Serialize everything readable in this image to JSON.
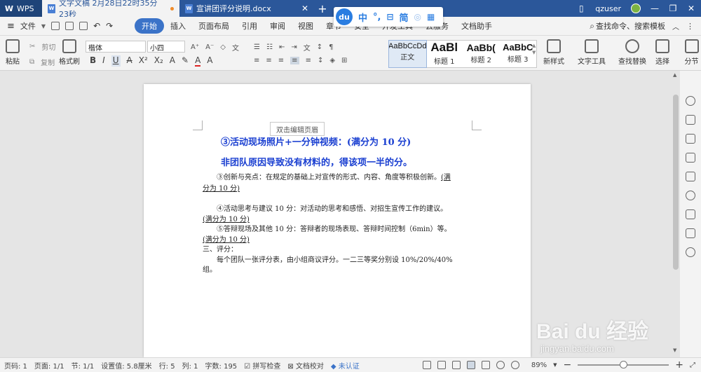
{
  "titlebar": {
    "app_tab": "WPS",
    "tabs": [
      {
        "label": "文字文稿 2月28日22时35分23秒",
        "active": true
      },
      {
        "label": "宣讲团评分说明.docx",
        "active": false
      }
    ],
    "user": "qzuser"
  },
  "ime": {
    "logo": "du",
    "items": [
      "中",
      "°,",
      "简"
    ]
  },
  "menubar": {
    "file": "文件",
    "items": [
      "开始",
      "插入",
      "页面布局",
      "引用",
      "审阅",
      "视图",
      "章节",
      "安全",
      "开发工具",
      "云服务",
      "文档助手"
    ],
    "active": "开始",
    "search": "查找命令、搜索模板"
  },
  "ribbon": {
    "paste": "粘贴",
    "cut": "剪切",
    "copy": "复制",
    "format_painter": "格式刷",
    "font": "楷体",
    "size": "小四",
    "styles": [
      {
        "sample": "AaBbCcDd",
        "name": "正文"
      },
      {
        "sample": "AaBl",
        "name": "标题 1"
      },
      {
        "sample": "AaBb(",
        "name": "标题 2"
      },
      {
        "sample": "AaBbC",
        "name": "标题 3"
      }
    ],
    "new_style": "新样式",
    "text_tools": "文字工具",
    "find_replace": "查找替换",
    "select": "选择",
    "more": "分节"
  },
  "document": {
    "header_tip": "双击编辑页眉",
    "title1": "③活动现场照片+一分钟视频：(满分为 10 分)",
    "title2": "非团队原因导致没有材料的，得该项一半的分。",
    "p3a": "③创新与亮点：在规定的基础上对宣传的形式、内容、角度等积极创新。",
    "p3b": "(满",
    "p3c": "分为 10 分)",
    "p4a": "④活动思考与建议 10 分：对活动的思考和感悟、对招生宣传工作的建议。",
    "p4b": "(满分为 10 分)",
    "p5a": "⑤答辩现场及其他 10 分：答辩者的现场表现、答辩时间控制（6min）等。",
    "p5b": "(满分为 10 分)",
    "p6": "三、评分：",
    "p7a": "每个团队一张评分表，由小组商议评分。一二三等奖分别设 10%/20%/40%",
    "p7b": "组。"
  },
  "statusbar": {
    "page_no": "页码: 1",
    "pages": "页面: 1/1",
    "section": "节: 1/1",
    "setting": "设置值: 5.8厘米",
    "row": "行: 5",
    "col": "列: 1",
    "words": "字数: 195",
    "spell": "拼写检查",
    "proof": "文档校对",
    "auth": "未认证",
    "zoom": "89%"
  },
  "watermark": {
    "main": "Bai du 经验",
    "sub": "jingyan.baidu.com"
  }
}
